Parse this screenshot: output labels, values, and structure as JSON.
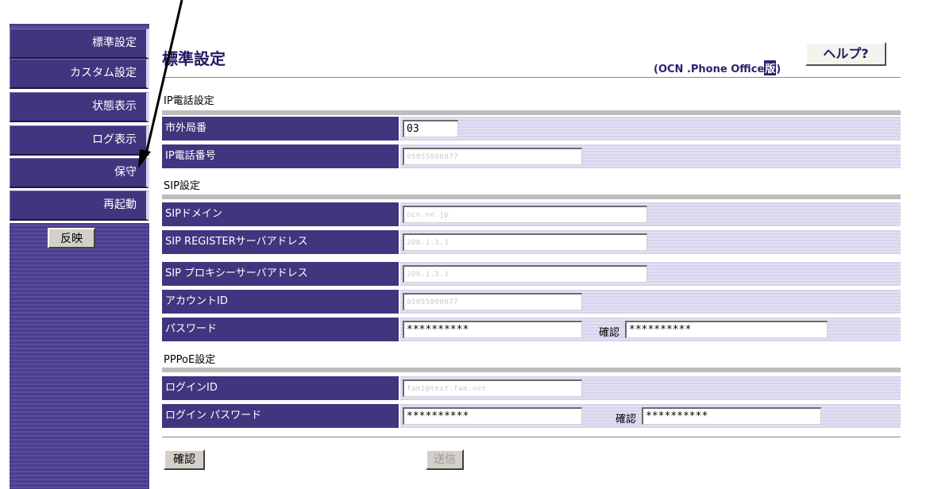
{
  "sidebar": {
    "items": [
      {
        "label": "標準設定"
      },
      {
        "label": "カスタム設定"
      },
      {
        "label": "状態表示"
      },
      {
        "label": "ログ表示"
      },
      {
        "label": "保守"
      },
      {
        "label": "再起動"
      }
    ],
    "reflect_label": "反映"
  },
  "header": {
    "title": "標準設定",
    "edition_prefix": "(OCN .Phone Office",
    "edition_ban": "版",
    "edition_suffix": ")",
    "help_label": "ヘルプ?"
  },
  "ip": {
    "section_title": "IP電話設定",
    "area_code_label": "市外局番",
    "area_code_value": "03",
    "phone_label": "IP電話番号",
    "phone_value": "05055000077"
  },
  "sip": {
    "section_title": "SIP設定",
    "domain_label": "SIPドメイン",
    "domain_value": "ocn.ne.jp",
    "register_label": "SIP REGISTERサーバアドレス",
    "register_value": "200.1.3.1",
    "proxy_label": "SIP プロキシーサーバアドレス",
    "proxy_value": "200.1.3.1",
    "account_label": "アカウントID",
    "account_value": "05055000077",
    "password_label": "パスワード",
    "password_value": "**********",
    "confirm_label": "確認",
    "confirm_value": "**********"
  },
  "pppoe": {
    "section_title": "PPPoE設定",
    "login_label": "ログインID",
    "login_value": "fam1@test.fam.net",
    "password_label": "ログイン パスワード",
    "password_value": "**********",
    "confirm_label": "確認",
    "confirm_value": "**********"
  },
  "footer": {
    "confirm_label": "確認",
    "send_label": "送信"
  },
  "colors": {
    "nav": "#41357f",
    "row_bg": "#d6d4ec"
  }
}
